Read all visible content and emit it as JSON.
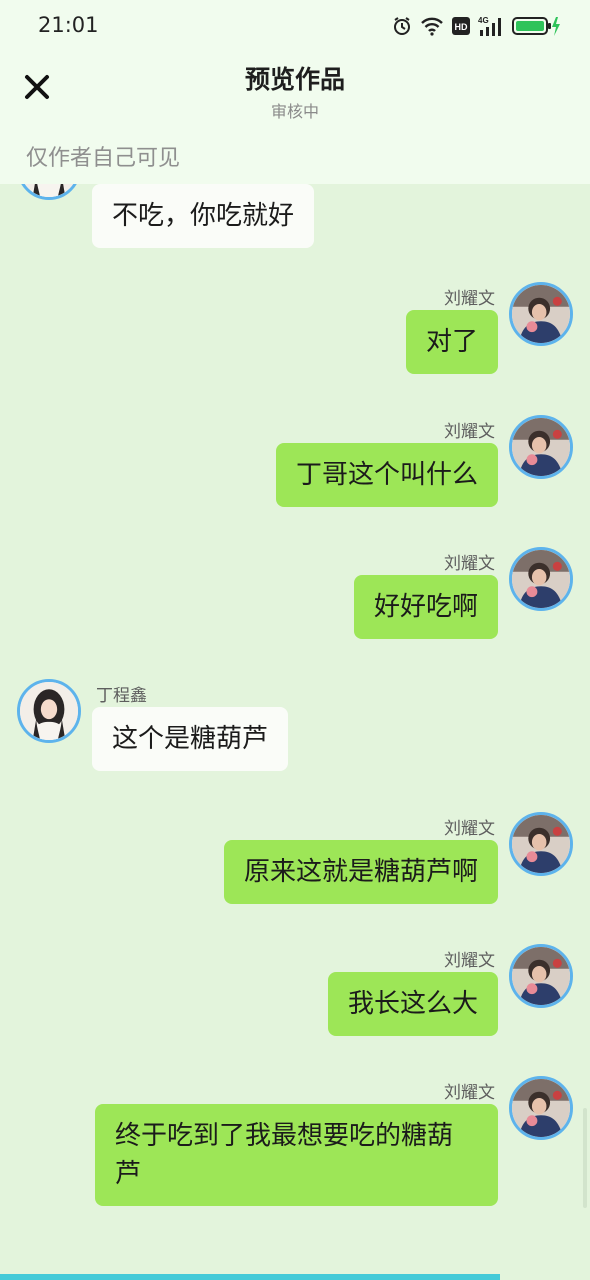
{
  "status_bar": {
    "time": "21:01",
    "icons": [
      "alarm-icon",
      "wifi-icon",
      "hd-icon",
      "cellular-4g-icon",
      "battery-charging-icon"
    ],
    "hd_text": "HD",
    "network_text": "4G"
  },
  "header": {
    "title": "预览作品",
    "subtitle": "审核中",
    "visibility_note": "仅作者自己可见",
    "close_icon": "close-icon"
  },
  "colors": {
    "header_bg": "#f1fcee",
    "chat_bg": "#e3f4dc",
    "self_bubble": "#9de657",
    "other_bubble": "#fafcf8",
    "avatar_ring": "#5db3ec"
  },
  "messages": [
    {
      "side": "left",
      "sender": "",
      "text": "不吃，你吃就好"
    },
    {
      "side": "right",
      "sender": "刘耀文",
      "text": "对了"
    },
    {
      "side": "right",
      "sender": "刘耀文",
      "text": "丁哥这个叫什么"
    },
    {
      "side": "right",
      "sender": "刘耀文",
      "text": "好好吃啊"
    },
    {
      "side": "left",
      "sender": "丁程鑫",
      "text": "这个是糖葫芦"
    },
    {
      "side": "right",
      "sender": "刘耀文",
      "text": "原来这就是糖葫芦啊"
    },
    {
      "side": "right",
      "sender": "刘耀文",
      "text": "我长这么大"
    },
    {
      "side": "right",
      "sender": "刘耀文",
      "text": "终于吃到了我最想要吃的糖葫芦"
    }
  ]
}
